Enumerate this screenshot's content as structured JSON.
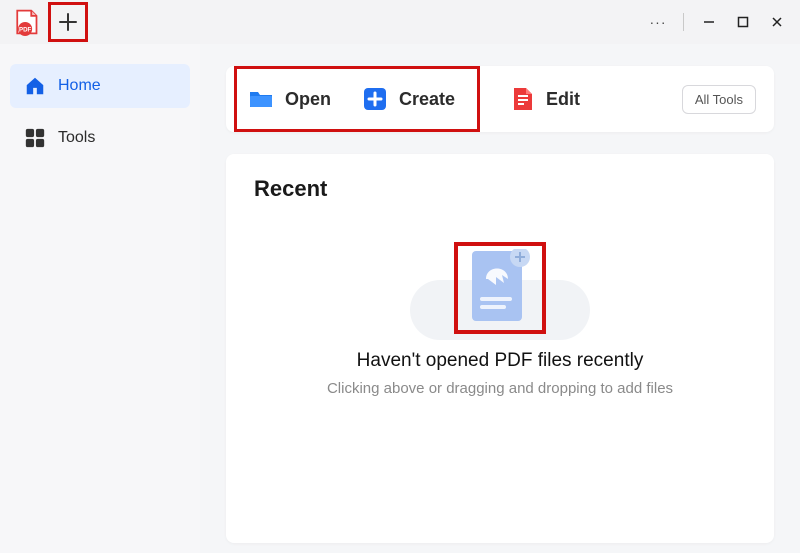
{
  "titlebar": {
    "kebab": "···"
  },
  "sidebar": {
    "items": [
      {
        "label": "Home"
      },
      {
        "label": "Tools"
      }
    ]
  },
  "actions": {
    "open": "Open",
    "create": "Create",
    "edit": "Edit",
    "alltools": "All Tools"
  },
  "recent": {
    "title": "Recent",
    "empty_title": "Haven't opened PDF files recently",
    "empty_sub": "Clicking above or dragging and dropping to add files"
  }
}
